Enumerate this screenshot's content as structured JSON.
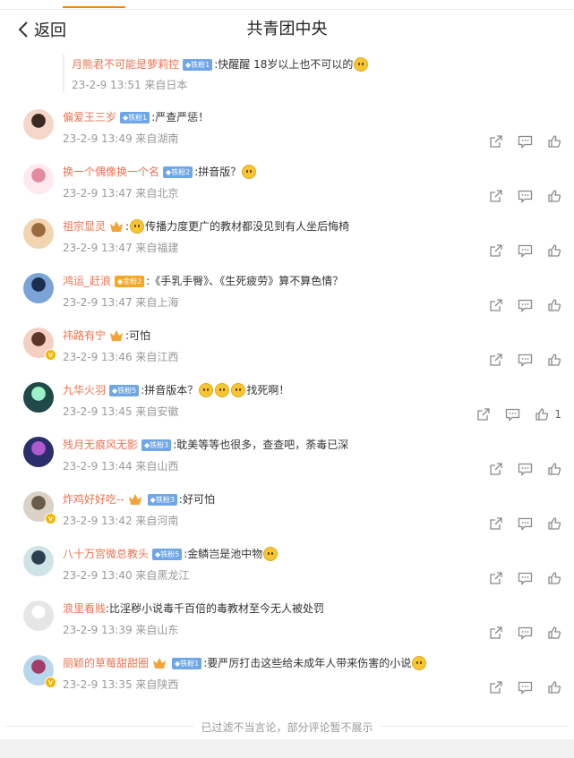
{
  "nav": {
    "back_label": "返回",
    "title": "共青团中央"
  },
  "reply": {
    "user": "月熊君不可能是萝莉控",
    "fan_badge": "铁粉1",
    "text": ":快醒醒 18岁以上也不可以的",
    "meta": "23-2-9 13:51 来自日本"
  },
  "comments": [
    {
      "user": "偏爱王三岁",
      "fan_badge": "铁粉1",
      "text": ":严查严惩！",
      "meta": "23-2-9 13:49 来自湖南",
      "like_count": ""
    },
    {
      "user": "换一个偶像换一个名",
      "fan_badge": "铁粉2",
      "text": ":拼音版？",
      "meta": "23-2-9 13:47 来自北京",
      "like_count": ""
    },
    {
      "user": "祖宗显灵",
      "text": "传播力度更广的教材都没见到有人坐后悔椅",
      "meta": "23-2-9 13:47 来自福建",
      "like_count": ""
    },
    {
      "user": "鸿运_赶浪",
      "fan_badge": "金粉2",
      "text": ":《手乳手臀》、《生死疲劳》算不算色情？",
      "meta": "23-2-9 13:47 来自上海",
      "like_count": ""
    },
    {
      "user": "祎路有宁",
      "text": ":可怕",
      "meta": "23-2-9 13:46 来自江西",
      "like_count": ""
    },
    {
      "user": "九华火羽",
      "fan_badge": "铁粉5",
      "text": ":拼音版本？",
      "text2": "找死啊！",
      "meta": "23-2-9 13:45 来自安徽",
      "like_count": "1"
    },
    {
      "user": "残月无痕风无影",
      "fan_badge": "铁粉3",
      "text": ":耽美等等也很多，查查吧，荼毒已深",
      "meta": "23-2-9 13:44 来自山西",
      "like_count": ""
    },
    {
      "user": "炸鸡好好吃--",
      "fan_badge": "铁粉3",
      "text": ":好可怕",
      "meta": "23-2-9 13:42 来自河南",
      "like_count": ""
    },
    {
      "user": "八十万宫微总教头",
      "fan_badge": "铁粉5",
      "text": ":金鳞岂是池中物",
      "meta": "23-2-9 13:40 来自黑龙江",
      "like_count": ""
    },
    {
      "user": "浪里看贱",
      "text": ":比淫秽小说毒千百倍的毒教材至今无人被处罚",
      "meta": "23-2-9 13:39 来自山东",
      "like_count": ""
    },
    {
      "user": "丽颖的草莓甜甜圈",
      "fan_badge": "铁粉1",
      "text": ":要严厉打击这些给未成年人带来伤害的小说",
      "meta": "23-2-9 13:35 来自陕西",
      "like_count": ""
    }
  ],
  "footer": {
    "note": "已过滤不当言论，部分评论暂不展示"
  },
  "colors": {
    "username": "#eb7350",
    "accent_tab": "#ff8200",
    "fan_badge": "#6ea6e8",
    "vip_badge": "#f7b500"
  }
}
